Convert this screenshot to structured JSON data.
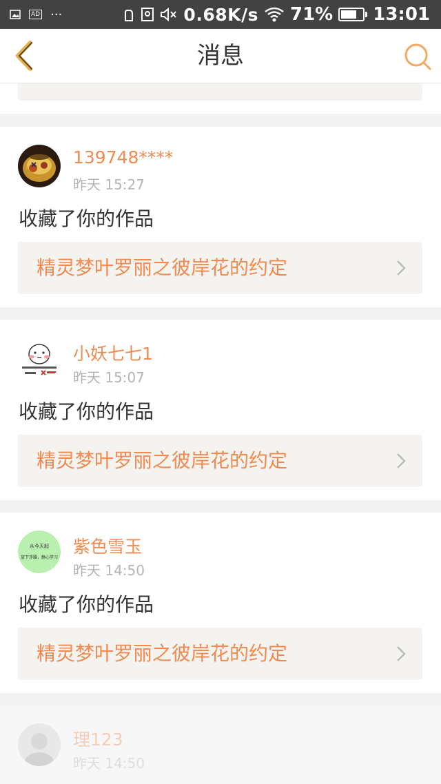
{
  "status_bar": {
    "ad_label": "AD",
    "more": "···",
    "speed": "0.68K/s",
    "battery_percent": "71%",
    "battery_level": 0.71,
    "time": "13:01"
  },
  "header": {
    "title": "消息"
  },
  "messages": [
    {
      "username": "",
      "time": "",
      "action": "",
      "item_title": "精灵梦叶罗丽之彼岸花的约定"
    },
    {
      "username": "139748****",
      "time": "昨天 15:27",
      "action": "收藏了你的作品",
      "item_title": "精灵梦叶罗丽之彼岸花的约定"
    },
    {
      "username": "小妖七七1",
      "time": "昨天 15:07",
      "action": "收藏了你的作品",
      "item_title": "精灵梦叶罗丽之彼岸花的约定"
    },
    {
      "username": "紫色雪玉",
      "time": "昨天 14:50",
      "action": "收藏了你的作品",
      "item_title": "精灵梦叶罗丽之彼岸花的约定",
      "avatar_text_1": "从今天起",
      "avatar_text_2": "放下浮躁，静心学习"
    },
    {
      "username": "理123",
      "time": "昨天 14:50"
    }
  ],
  "colors": {
    "accent": "#f08a50",
    "header_icon": "#e8b04a",
    "search_icon": "#f5a85f",
    "status_bar": "#424242"
  }
}
